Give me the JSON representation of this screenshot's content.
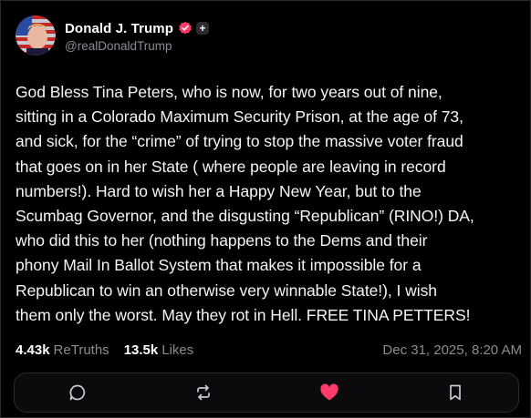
{
  "post": {
    "author_name": "Donald J. Trump",
    "author_handle": "@realDonaldTrump",
    "verified_icon": "verified-badge-icon",
    "plus_label": "+",
    "text": "God Bless Tina Peters, who is now, for two years out of nine,\nsitting in a Colorado Maximum Security Prison, at the age of 73,\nand sick, for the “crime” of trying to stop the massive voter fraud\nthat goes on in her State ( where people are leaving in record\nnumbers!). Hard to wish her a Happy New Year, but to the\nScumbag Governor, and the disgusting “Republican” (RINO!) DA,\nwho did this to her (nothing happens to the Dems and their\nphony Mail In Ballot System that makes it impossible for a\nRepublican to win an otherwise very winnable State!), I wish\nthem only the worst. May they rot in Hell. FREE TINA PETTERS!",
    "retruths_count": "4.43k",
    "retruths_label": "ReTruths",
    "likes_count": "13.5k",
    "likes_label": "Likes",
    "timestamp": "Dec 31, 2025, 8:20 AM"
  },
  "actions": [
    {
      "name": "reply",
      "icon": "reply-icon"
    },
    {
      "name": "retruth",
      "icon": "retruth-icon"
    },
    {
      "name": "like",
      "icon": "heart-icon",
      "active_color": "#ff3b6b"
    },
    {
      "name": "bookmark",
      "icon": "bookmark-icon"
    }
  ],
  "colors": {
    "background": "#000000",
    "muted": "#8b8b95",
    "verified": "#ff3b6b",
    "like_active": "#ff3b6b"
  }
}
